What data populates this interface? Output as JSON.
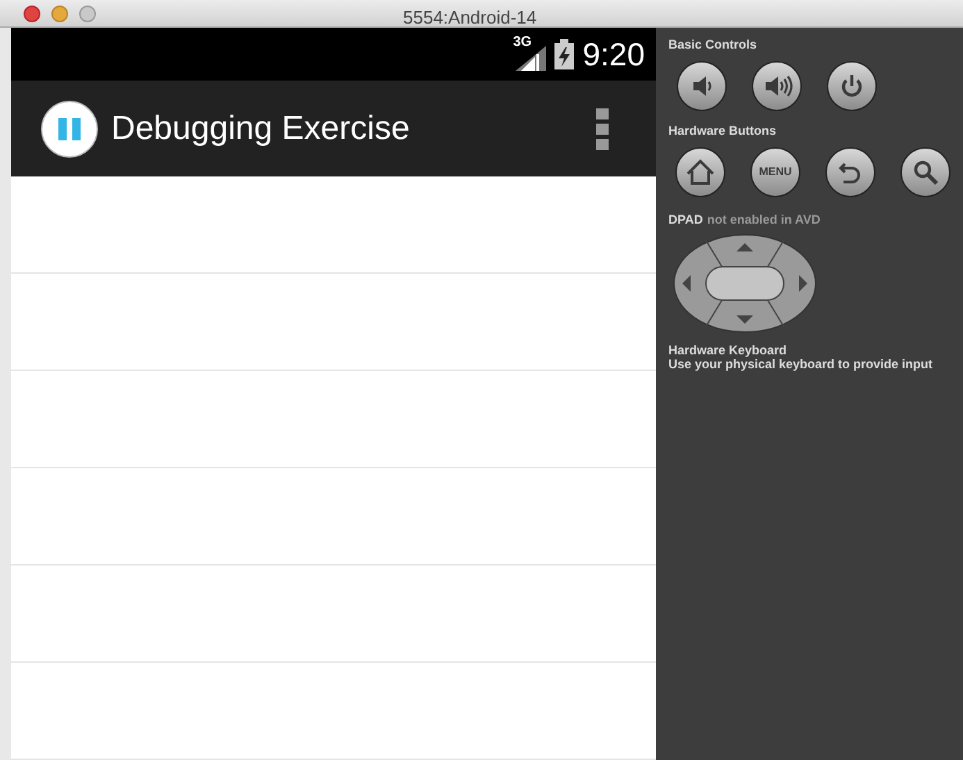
{
  "window": {
    "title": "5554:Android-14"
  },
  "status_bar": {
    "network": "3G",
    "time": "9:20"
  },
  "action_bar": {
    "title": "Debugging Exercise"
  },
  "controls": {
    "basic_title": "Basic Controls",
    "basic": [
      {
        "kind": "volume-down"
      },
      {
        "kind": "volume-up"
      },
      {
        "kind": "power"
      }
    ],
    "hardware_title": "Hardware Buttons",
    "hardware": [
      {
        "kind": "home"
      },
      {
        "kind": "menu",
        "label": "MENU"
      },
      {
        "kind": "back"
      },
      {
        "kind": "search"
      }
    ],
    "dpad_title": "DPAD",
    "dpad_note": "not enabled in AVD",
    "keyboard_title": "Hardware Keyboard",
    "keyboard_note": "Use your physical keyboard to provide input"
  }
}
